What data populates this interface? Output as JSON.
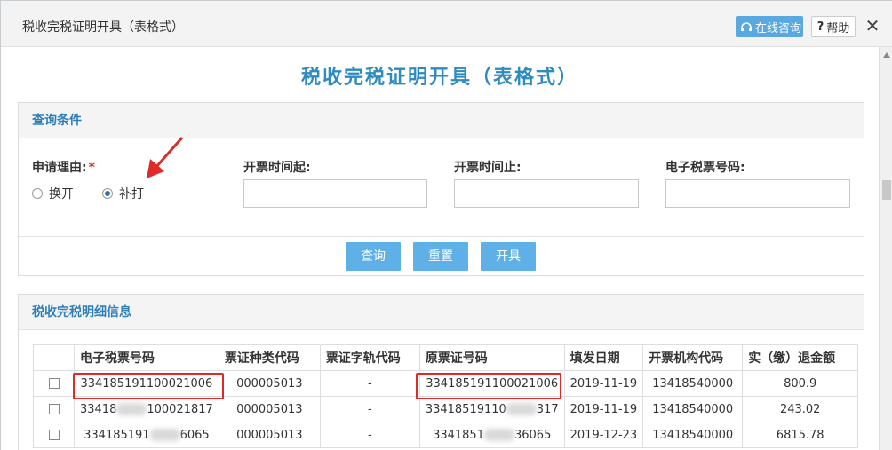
{
  "window": {
    "title": "税收完税证明开具（表格式）",
    "consult_label": "在线咨询",
    "help_label": "帮助",
    "close_symbol": "✕"
  },
  "page": {
    "heading": "税收完税证明开具（表格式）"
  },
  "query": {
    "section_title": "查询条件",
    "reason_label": "申请理由:",
    "required_mark": "*",
    "options": [
      {
        "label": "换开",
        "checked": false
      },
      {
        "label": "补打",
        "checked": true
      }
    ],
    "start_time_label": "开票时间起:",
    "end_time_label": "开票时间止:",
    "ticket_no_label": "电子税票号码:",
    "start_time_value": "",
    "end_time_value": "",
    "ticket_no_value": "",
    "buttons": {
      "query": "查询",
      "reset": "重置",
      "issue": "开具"
    }
  },
  "detail": {
    "section_title": "税收完税明细信息",
    "columns": [
      "电子税票号码",
      "票证种类代码",
      "票证字轨代码",
      "原票证号码",
      "填发日期",
      "开票机构代码",
      "实（缴）退金额"
    ],
    "rows": [
      {
        "ticket_a": "334185191100021006",
        "ticket_b": "",
        "kind": "000005013",
        "track": "-",
        "orig_a": "334185191100021006",
        "orig_b": "",
        "date": "2019-11-19",
        "org": "13418540000",
        "amount": "800.9"
      },
      {
        "ticket_a": "33418",
        "ticket_b": "100021817",
        "kind": "000005013",
        "track": "-",
        "orig_a": "33418519110",
        "orig_b": "317",
        "date": "2019-11-19",
        "org": "13418540000",
        "amount": "243.02"
      },
      {
        "ticket_a": "334185191",
        "ticket_b": "6065",
        "kind": "000005013",
        "track": "-",
        "orig_a": "3341851",
        "orig_b": "36065",
        "date": "2019-12-23",
        "org": "13418540000",
        "amount": "6815.78"
      }
    ]
  },
  "colors": {
    "accent": "#2e8bbf",
    "button": "#5fb0e6",
    "highlight": "#e02a2a",
    "arrow": "#e02a2a"
  }
}
